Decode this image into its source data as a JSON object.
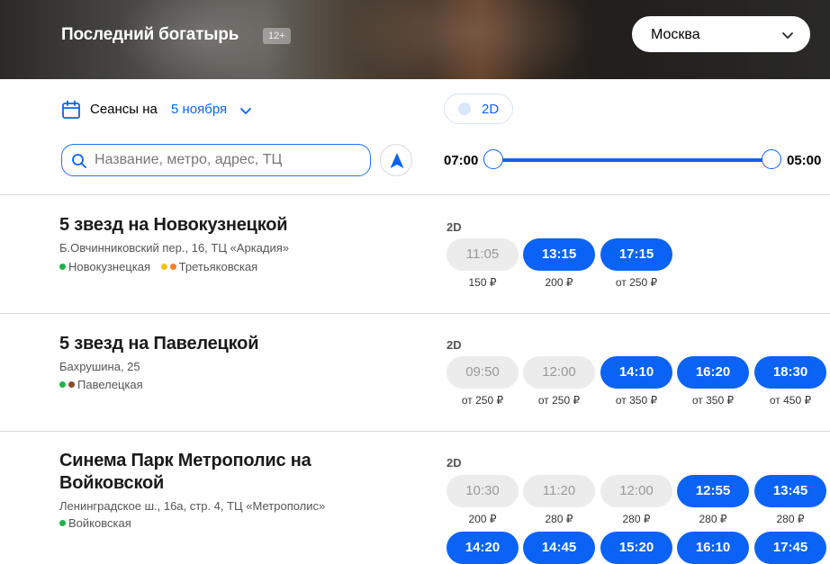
{
  "header": {
    "movie_title": "Последний богатырь",
    "age_rating": "12+",
    "city": "Москва"
  },
  "filters": {
    "sessions_label": "Сеансы на",
    "date": "5 ноября",
    "format": "2D",
    "search_placeholder": "Название, метро, адрес, ТЦ",
    "time_from": "07:00",
    "time_to": "05:00"
  },
  "colors": {
    "accent": "#0a63f5",
    "disabled": "#ececec"
  },
  "cinemas": [
    {
      "name": "5 звезд на Новокузнецкой",
      "address": "Б.Овчинниковский пер., 16, ТЦ «Аркадия»",
      "metros": [
        {
          "name": "Новокузнецкая",
          "colors": [
            "#1fb14a"
          ]
        },
        {
          "name": "Третьяковская",
          "colors": [
            "#f5c400",
            "#f57f26"
          ]
        }
      ],
      "format": "2D",
      "sessions": [
        {
          "time": "11:05",
          "price": "150 ₽",
          "available": false
        },
        {
          "time": "13:15",
          "price": "200 ₽",
          "available": true
        },
        {
          "time": "17:15",
          "price": "от 250 ₽",
          "available": true
        }
      ]
    },
    {
      "name": "5 звезд на Павелецкой",
      "address": "Бахрушина, 25",
      "metros": [
        {
          "name": "Павелецкая",
          "colors": [
            "#1fb14a",
            "#8b4a2b"
          ]
        }
      ],
      "format": "2D",
      "sessions": [
        {
          "time": "09:50",
          "price": "от 250 ₽",
          "available": false
        },
        {
          "time": "12:00",
          "price": "от 250 ₽",
          "available": false
        },
        {
          "time": "14:10",
          "price": "от 350 ₽",
          "available": true
        },
        {
          "time": "16:20",
          "price": "от 350 ₽",
          "available": true
        },
        {
          "time": "18:30",
          "price": "от 450 ₽",
          "available": true
        }
      ]
    },
    {
      "name": "Синема Парк Метрополис на Войковской",
      "address": "Ленинградское ш., 16а, стр. 4, ТЦ «Метрополис»",
      "metros": [
        {
          "name": "Войковская",
          "colors": [
            "#1fb14a"
          ]
        }
      ],
      "format": "2D",
      "sessions": [
        {
          "time": "10:30",
          "price": "200 ₽",
          "available": false
        },
        {
          "time": "11:20",
          "price": "280 ₽",
          "available": false
        },
        {
          "time": "12:00",
          "price": "280 ₽",
          "available": false
        },
        {
          "time": "12:55",
          "price": "280 ₽",
          "available": true
        },
        {
          "time": "13:45",
          "price": "280 ₽",
          "available": true
        },
        {
          "time": "14:20",
          "price": "",
          "available": true
        },
        {
          "time": "14:45",
          "price": "",
          "available": true
        },
        {
          "time": "15:20",
          "price": "",
          "available": true
        },
        {
          "time": "16:10",
          "price": "",
          "available": true
        },
        {
          "time": "17:45",
          "price": "",
          "available": true
        }
      ]
    }
  ]
}
